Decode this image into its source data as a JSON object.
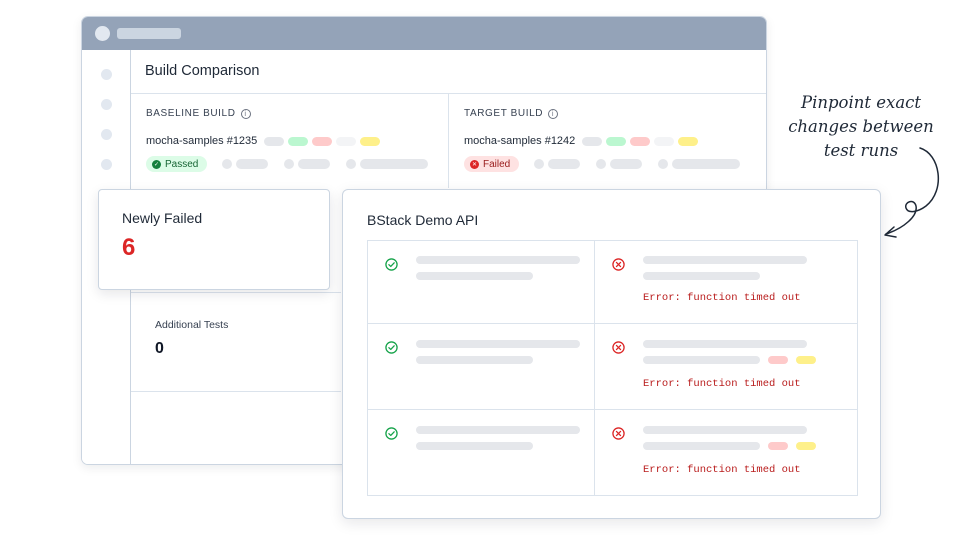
{
  "window": {
    "title": "Build Comparison",
    "baseline": {
      "label": "BASELINE BUILD",
      "name": "mocha-samples #1235",
      "status": "Passed",
      "status_color": "#166534"
    },
    "target": {
      "label": "TARGET BUILD",
      "name": "mocha-samples #1242",
      "status": "Failed",
      "status_color": "#991b1b"
    },
    "additional_tests": {
      "label": "Additional Tests",
      "value": "0"
    }
  },
  "newly_failed": {
    "label": "Newly Failed",
    "value": "6",
    "value_color": "#dc2626"
  },
  "api_card": {
    "title": "BStack Demo API",
    "rows": [
      {
        "left_status": "pass",
        "right_status": "fail",
        "error": "Error: function timed out"
      },
      {
        "left_status": "pass",
        "right_status": "fail",
        "error": "Error: function timed out"
      },
      {
        "left_status": "pass",
        "right_status": "fail",
        "error": "Error: function timed out"
      }
    ]
  },
  "annotation": {
    "line1": "Pinpoint exact",
    "line2": "changes between",
    "line3": "test runs"
  },
  "colors": {
    "pass_icon": "#16a34a",
    "fail_icon": "#dc2626",
    "error_text": "#b91c1c",
    "titlebar": "#94a3b8"
  }
}
